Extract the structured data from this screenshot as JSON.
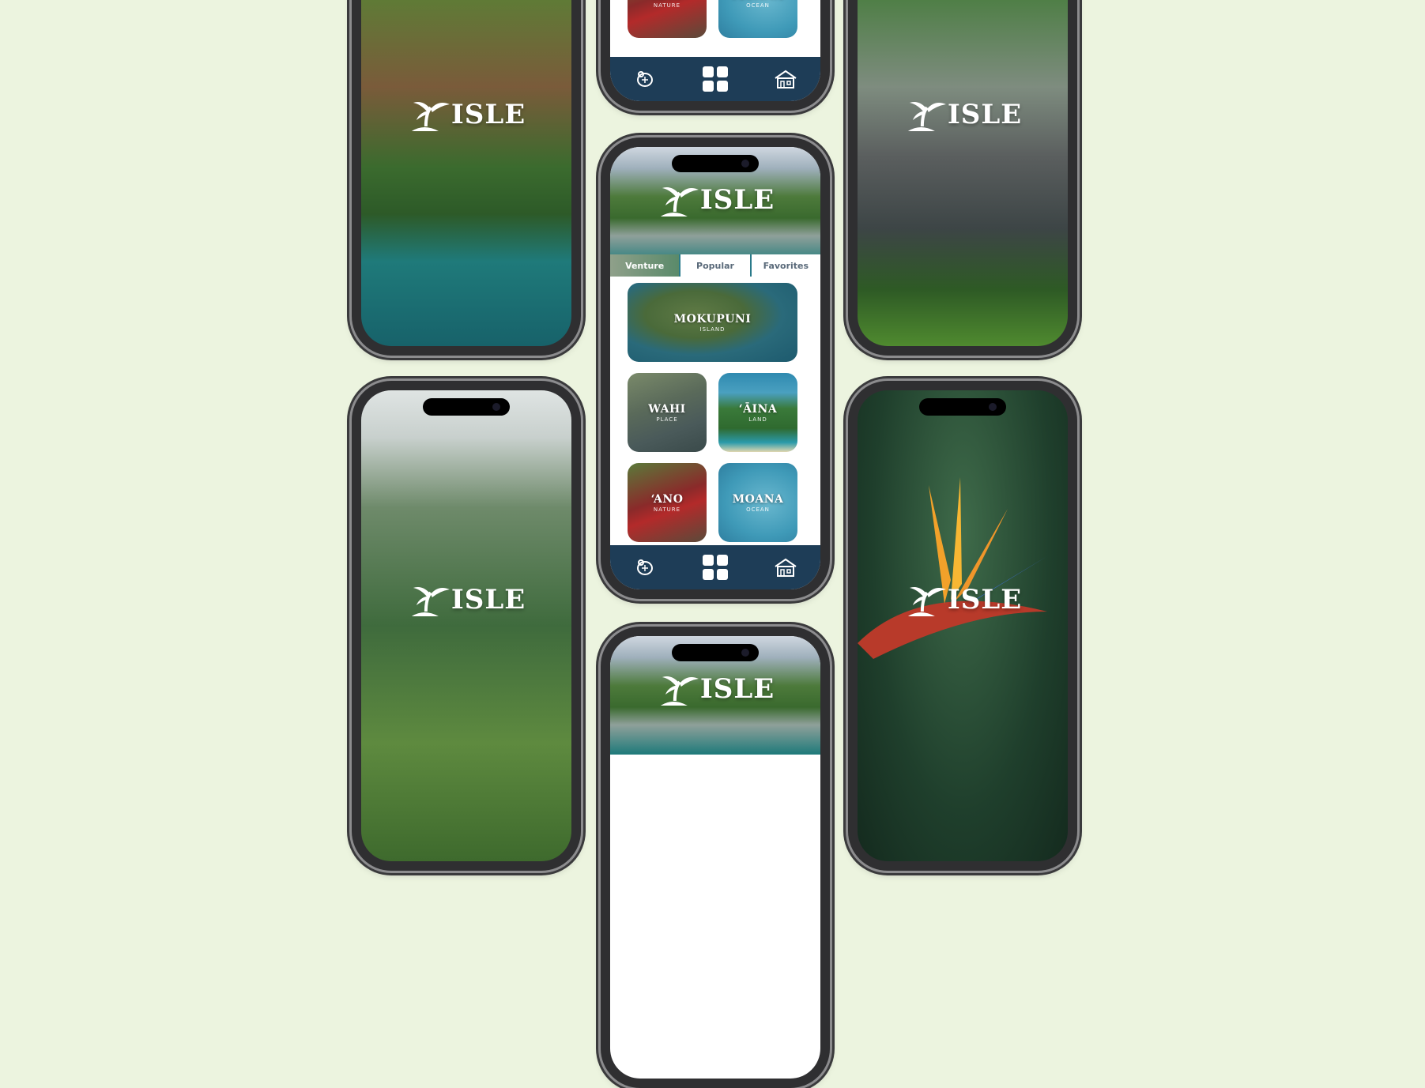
{
  "brand": {
    "name": "ISLE"
  },
  "colors": {
    "background": "#ecf4df",
    "navbar": "#1e3d57",
    "tab_divider": "#2a7a8a"
  },
  "tabs": [
    {
      "label": "Venture",
      "active": true
    },
    {
      "label": "Popular",
      "active": false
    },
    {
      "label": "Favorites",
      "active": false
    }
  ],
  "tiles": {
    "mokupuni": {
      "title": "MOKUPUNI",
      "subtitle": "ISLAND"
    },
    "wahi": {
      "title": "WAHI",
      "subtitle": "PLACE"
    },
    "aina": {
      "title": "ʻĀINA",
      "subtitle": "LAND"
    },
    "ano": {
      "title": "ʻANO",
      "subtitle": "NATURE"
    },
    "moana": {
      "title": "MOANA",
      "subtitle": "OCEAN"
    }
  },
  "navbar": {
    "icons": [
      "turtle-icon",
      "grid-icon",
      "house-icon"
    ]
  }
}
